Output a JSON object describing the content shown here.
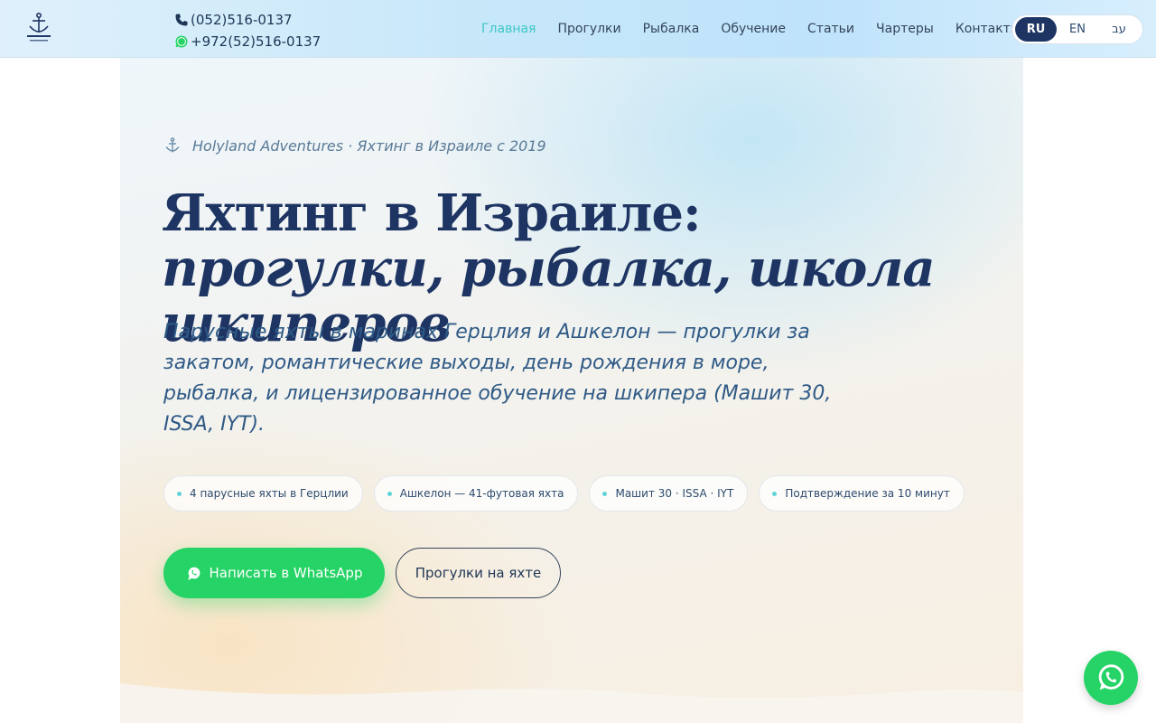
{
  "header": {
    "phone": "(052)516-0137",
    "whatsapp": "+972(52)516-0137",
    "nav": [
      {
        "label": "Главная",
        "active": true
      },
      {
        "label": "Прогулки"
      },
      {
        "label": "Рыбалка"
      },
      {
        "label": "Обучение"
      },
      {
        "label": "Статьи"
      },
      {
        "label": "Чартеры"
      },
      {
        "label": "Контакты"
      }
    ],
    "languages": [
      {
        "label": "RU",
        "active": true
      },
      {
        "label": "EN"
      },
      {
        "label": "עב"
      }
    ]
  },
  "hero": {
    "eyebrow": "Holyland Adventures · Яхтинг в Израиле с 2019",
    "title_plain": "Яхтинг в Израиле: ",
    "title_italic": "прогулки, рыбалка, школа шкиперов",
    "lead": "Парусные яхты в маринах Герцлия и Ашкелон — прогулки за закатом, романтические выходы, день рождения в море, рыбалка, и лицензированное обучение на шкипера (Машит 30, ISSA, IYT).",
    "chips": [
      "4 парусные яхты в Герцлии",
      "Ашкелон — 41-футовая яхта",
      "Машит 30 · ISSA · IYT",
      "Подтверждение за 10 минут"
    ],
    "primary_button": "Написать в WhatsApp",
    "secondary_button": "Прогулки на яхте"
  },
  "colors": {
    "navy": "#1e3563",
    "accent": "#3ec7c7",
    "whatsapp": "#26d366"
  },
  "icons": {
    "phone": "phone-icon",
    "whatsapp": "whatsapp-icon",
    "anchor": "anchor-icon"
  }
}
